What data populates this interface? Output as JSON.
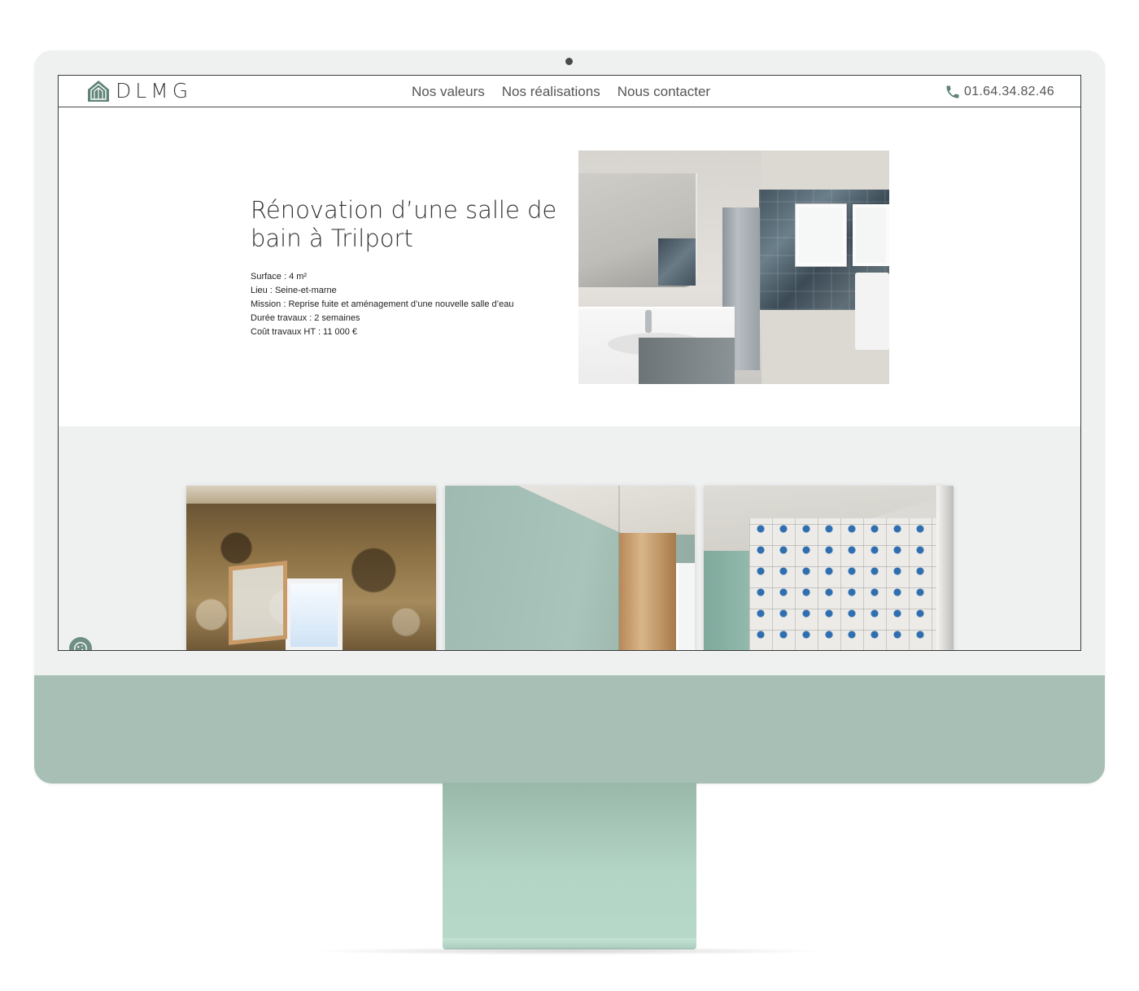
{
  "site": {
    "logo_text": "DLMG",
    "brand_color": "#5f8376",
    "nav": [
      {
        "label": "Nos valeurs"
      },
      {
        "label": "Nos réalisations"
      },
      {
        "label": "Nous contacter"
      }
    ],
    "phone": "01.64.34.82.46"
  },
  "hero": {
    "title": "Rénovation d’une salle de bain à Trilport",
    "details": [
      "Surface : 4 m²",
      "Lieu : Seine-et-marne",
      "Mission : Reprise fuite et aménagement d’une nouvelle salle d’eau",
      "Durée travaux : 2 semaines",
      "Coût travaux HT : 11 000 €"
    ]
  },
  "colors": {
    "monitor_chin": "#a8bfb5",
    "stand": "#b2d4c5",
    "gallery_bg": "#eff0f0"
  },
  "icons": {
    "logo": "house-logo-icon",
    "phone": "phone-icon",
    "cookie": "cookie-icon"
  }
}
